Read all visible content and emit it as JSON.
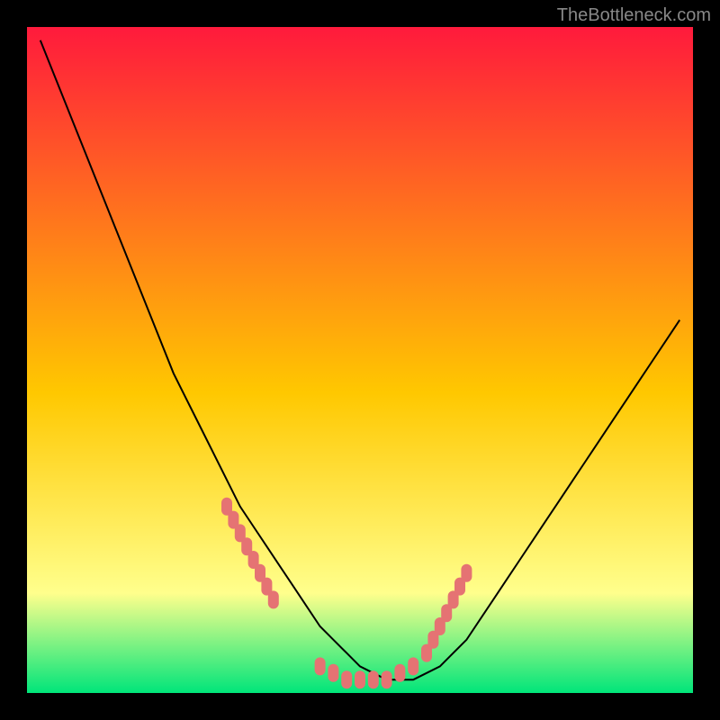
{
  "watermark": "TheBottleneck.com",
  "chart_data": {
    "type": "line",
    "title": "",
    "xlabel": "",
    "ylabel": "",
    "xlim": [
      0,
      100
    ],
    "ylim": [
      0,
      100
    ],
    "grid": false,
    "background_gradient": {
      "top": "#ff1a3c",
      "mid1": "#ffc800",
      "mid2": "#ffff8c",
      "bottom": "#00e57a"
    },
    "series": [
      {
        "name": "bottleneck-curve",
        "x": [
          2,
          4,
          6,
          8,
          10,
          12,
          14,
          16,
          18,
          20,
          22,
          24,
          26,
          28,
          30,
          32,
          34,
          36,
          38,
          40,
          42,
          44,
          46,
          48,
          50,
          52,
          54,
          56,
          58,
          60,
          62,
          64,
          66,
          68,
          70,
          72,
          74,
          76,
          78,
          80,
          82,
          84,
          86,
          88,
          90,
          92,
          94,
          96,
          98
        ],
        "y": [
          98,
          93,
          88,
          83,
          78,
          73,
          68,
          63,
          58,
          53,
          48,
          44,
          40,
          36,
          32,
          28,
          25,
          22,
          19,
          16,
          13,
          10,
          8,
          6,
          4,
          3,
          2,
          2,
          2,
          3,
          4,
          6,
          8,
          11,
          14,
          17,
          20,
          23,
          26,
          29,
          32,
          35,
          38,
          41,
          44,
          47,
          50,
          53,
          56
        ]
      }
    ],
    "markers": [
      {
        "name": "left-cluster",
        "x": [
          30,
          31,
          32,
          33,
          34,
          35,
          36,
          37
        ],
        "y": [
          28,
          26,
          24,
          22,
          20,
          18,
          16,
          14
        ]
      },
      {
        "name": "bottom-cluster",
        "x": [
          44,
          46,
          48,
          50,
          52,
          54,
          56,
          58
        ],
        "y": [
          4,
          3,
          2,
          2,
          2,
          2,
          3,
          4
        ]
      },
      {
        "name": "right-cluster",
        "x": [
          60,
          61,
          62,
          63,
          64,
          65,
          66
        ],
        "y": [
          6,
          8,
          10,
          12,
          14,
          16,
          18
        ]
      }
    ],
    "marker_color": "#e57373",
    "curve_color": "#000000"
  }
}
